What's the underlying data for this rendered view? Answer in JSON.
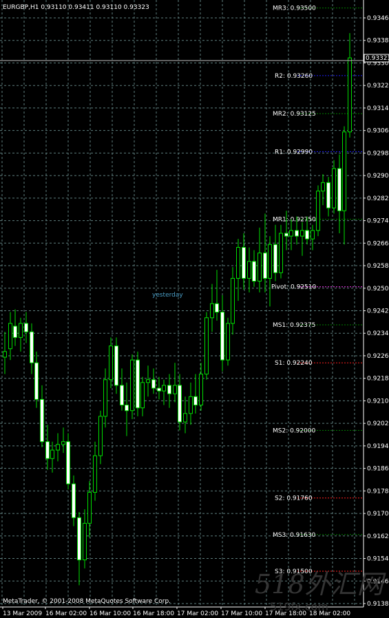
{
  "window": {
    "symbol_info": "EURGBP,H1  0.93110 0.93411 0.93110 0.93323",
    "copyright": "MetaTrader, © 2001-2008 MetaQuotes Software Corp.",
    "watermark": "518外汇网",
    "watermark_url": "519fx.com"
  },
  "colors": {
    "background": "#000000",
    "grid": "#5f7f7f",
    "bull_body": "#000000",
    "bear_body": "#ffffff",
    "wick": "#00e000",
    "text": "#ffffff",
    "resistance": "#2020ff",
    "support": "#ff2020",
    "mid_level": "#008000",
    "pivot": "#ff40ff",
    "yesterday": "#4a9ec6",
    "price_box_bg": "#000000"
  },
  "chart_data": {
    "type": "candlestick",
    "price_scale": [
      "0.93465",
      "0.93385",
      "0.93305",
      "0.93225",
      "0.93145",
      "0.93065",
      "0.92985",
      "0.92905",
      "0.92825",
      "0.92745",
      "0.92665",
      "0.92585",
      "0.92505",
      "0.92425",
      "0.92345",
      "0.92265",
      "0.92185",
      "0.92105",
      "0.92025",
      "0.91945",
      "0.91865",
      "0.91785",
      "0.91705",
      "0.91625",
      "0.91545",
      "0.91465",
      "0.91385"
    ],
    "current_price": "0.93323",
    "time_labels": [
      "13 Mar 2009",
      "16 Mar 02:00",
      "16 Mar 10:00",
      "16 Mar 18:00",
      "17 Mar 02:00",
      "17 Mar 10:00",
      "17 Mar 18:00",
      "18 Mar 02:00"
    ],
    "yesterday_label": "yesterday",
    "levels": [
      {
        "label": "MR3: 0.93500",
        "price": 0.935,
        "kind": "mid"
      },
      {
        "label": "R2: 0.93260",
        "price": 0.9326,
        "kind": "resistance"
      },
      {
        "label": "MR2: 0.93125",
        "price": 0.93125,
        "kind": "mid"
      },
      {
        "label": "R1: 0.92990",
        "price": 0.9299,
        "kind": "resistance"
      },
      {
        "label": "MR1: 0.92750",
        "price": 0.9275,
        "kind": "mid"
      },
      {
        "label": "Pivot: 0.92510",
        "price": 0.9251,
        "kind": "pivot"
      },
      {
        "label": "MS1: 0.92375",
        "price": 0.92375,
        "kind": "mid"
      },
      {
        "label": "S1: 0.92240",
        "price": 0.9224,
        "kind": "support"
      },
      {
        "label": "MS2: 0.92000",
        "price": 0.92,
        "kind": "mid"
      },
      {
        "label": "S2: 0.91760",
        "price": 0.9176,
        "kind": "support"
      },
      {
        "label": "MS3: 0.91630",
        "price": 0.9163,
        "kind": "mid"
      },
      {
        "label": "S3: 0.91500",
        "price": 0.915,
        "kind": "support"
      }
    ],
    "ohlc": [
      [
        0.9226,
        0.9235,
        0.922,
        0.9228
      ],
      [
        0.9229,
        0.9242,
        0.9225,
        0.9238
      ],
      [
        0.9237,
        0.9243,
        0.923,
        0.9233
      ],
      [
        0.9233,
        0.924,
        0.9228,
        0.9238
      ],
      [
        0.9238,
        0.9242,
        0.9231,
        0.9235
      ],
      [
        0.9235,
        0.9238,
        0.922,
        0.9224
      ],
      [
        0.9224,
        0.9228,
        0.9208,
        0.9211
      ],
      [
        0.9211,
        0.9216,
        0.9194,
        0.9196
      ],
      [
        0.9196,
        0.9202,
        0.9186,
        0.919
      ],
      [
        0.919,
        0.9196,
        0.9185,
        0.9193
      ],
      [
        0.9193,
        0.9199,
        0.9189,
        0.9195
      ],
      [
        0.9195,
        0.9201,
        0.9192,
        0.9196
      ],
      [
        0.9196,
        0.9199,
        0.9179,
        0.9181
      ],
      [
        0.9181,
        0.9184,
        0.9166,
        0.9169
      ],
      [
        0.9169,
        0.9171,
        0.9145,
        0.9154
      ],
      [
        0.9154,
        0.9172,
        0.9151,
        0.9167
      ],
      [
        0.9167,
        0.9182,
        0.9162,
        0.9178
      ],
      [
        0.9178,
        0.9196,
        0.9175,
        0.9191
      ],
      [
        0.9191,
        0.9207,
        0.9188,
        0.9205
      ],
      [
        0.9205,
        0.9222,
        0.9201,
        0.9218
      ],
      [
        0.9218,
        0.9233,
        0.9215,
        0.923
      ],
      [
        0.923,
        0.9233,
        0.9213,
        0.9216
      ],
      [
        0.9216,
        0.9222,
        0.9207,
        0.9209
      ],
      [
        0.9209,
        0.9217,
        0.9198,
        0.9207
      ],
      [
        0.9207,
        0.9227,
        0.9204,
        0.9225
      ],
      [
        0.9225,
        0.9228,
        0.9205,
        0.9208
      ],
      [
        0.9208,
        0.9219,
        0.9205,
        0.9217
      ],
      [
        0.9217,
        0.9223,
        0.9212,
        0.9218
      ],
      [
        0.9218,
        0.9222,
        0.9213,
        0.9215
      ],
      [
        0.9215,
        0.9219,
        0.9211,
        0.9214
      ],
      [
        0.9214,
        0.9218,
        0.9209,
        0.9216
      ],
      [
        0.9216,
        0.922,
        0.9208,
        0.9213
      ],
      [
        0.9213,
        0.9224,
        0.921,
        0.9216
      ],
      [
        0.9216,
        0.922,
        0.92,
        0.9203
      ],
      [
        0.9203,
        0.9212,
        0.9199,
        0.9206
      ],
      [
        0.9206,
        0.9217,
        0.9202,
        0.9212
      ],
      [
        0.9212,
        0.922,
        0.9206,
        0.9209
      ],
      [
        0.9209,
        0.9224,
        0.9207,
        0.922
      ],
      [
        0.922,
        0.9242,
        0.9218,
        0.924
      ],
      [
        0.924,
        0.9252,
        0.9235,
        0.9245
      ],
      [
        0.9245,
        0.9257,
        0.9239,
        0.9242
      ],
      [
        0.9242,
        0.9248,
        0.9221,
        0.9225
      ],
      [
        0.9225,
        0.924,
        0.9223,
        0.9238
      ],
      [
        0.9238,
        0.9258,
        0.9234,
        0.9254
      ],
      [
        0.9254,
        0.9268,
        0.9246,
        0.9265
      ],
      [
        0.9265,
        0.927,
        0.925,
        0.9254
      ],
      [
        0.9254,
        0.9265,
        0.9249,
        0.926
      ],
      [
        0.926,
        0.9264,
        0.9251,
        0.9253
      ],
      [
        0.9253,
        0.9272,
        0.9249,
        0.9263
      ],
      [
        0.9263,
        0.9277,
        0.9249,
        0.9254
      ],
      [
        0.9254,
        0.9269,
        0.9244,
        0.9266
      ],
      [
        0.9266,
        0.9273,
        0.9253,
        0.9256
      ],
      [
        0.9256,
        0.9273,
        0.9254,
        0.927
      ],
      [
        0.927,
        0.9278,
        0.9264,
        0.9269
      ],
      [
        0.9269,
        0.9275,
        0.9264,
        0.9271
      ],
      [
        0.9271,
        0.9276,
        0.9266,
        0.9269
      ],
      [
        0.9269,
        0.9274,
        0.9262,
        0.9271
      ],
      [
        0.9271,
        0.9276,
        0.9266,
        0.9268
      ],
      [
        0.9268,
        0.9273,
        0.9264,
        0.9271
      ],
      [
        0.9271,
        0.9287,
        0.9269,
        0.9285
      ],
      [
        0.9285,
        0.9291,
        0.928,
        0.9288
      ],
      [
        0.9288,
        0.929,
        0.9276,
        0.9279
      ],
      [
        0.9279,
        0.9296,
        0.9277,
        0.9293
      ],
      [
        0.9293,
        0.9298,
        0.927,
        0.9278
      ],
      [
        0.9278,
        0.9308,
        0.9266,
        0.9306
      ],
      [
        0.9306,
        0.93411,
        0.9304,
        0.93323
      ]
    ]
  }
}
